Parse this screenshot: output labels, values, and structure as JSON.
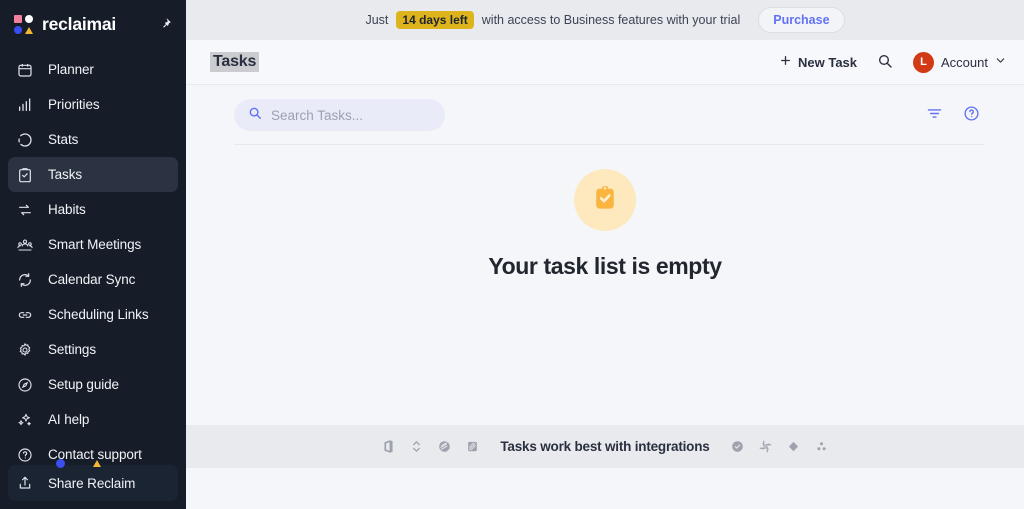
{
  "brand": {
    "name": "reclaimai",
    "logo_icon": "reclaim-logo-icon",
    "pin_icon": "pin-icon"
  },
  "sidebar": {
    "items": [
      {
        "label": "Planner",
        "icon": "calendar-icon",
        "active": false
      },
      {
        "label": "Priorities",
        "icon": "bar-chart-icon",
        "active": false
      },
      {
        "label": "Stats",
        "icon": "activity-circle-icon",
        "active": false
      },
      {
        "label": "Tasks",
        "icon": "clipboard-check-icon",
        "active": true
      },
      {
        "label": "Habits",
        "icon": "repeat-icon",
        "active": false
      },
      {
        "label": "Smart Meetings",
        "icon": "people-group-icon",
        "active": false
      },
      {
        "label": "Calendar Sync",
        "icon": "sync-refresh-icon",
        "active": false
      },
      {
        "label": "Scheduling Links",
        "icon": "link-icon",
        "active": false
      },
      {
        "label": "Settings",
        "icon": "gear-icon",
        "active": false
      },
      {
        "label": "Setup guide",
        "icon": "compass-icon",
        "active": false
      },
      {
        "label": "AI help",
        "icon": "sparkles-icon",
        "active": false
      },
      {
        "label": "Contact support",
        "icon": "question-circle-icon",
        "active": false
      }
    ],
    "share": {
      "label": "Share Reclaim",
      "icon": "share-upload-icon",
      "badge_dot_color": "#3b4ef0",
      "badge_triangle_color": "#f5b731"
    }
  },
  "banner": {
    "prefix": "Just",
    "highlight": "14 days left",
    "suffix": "with access to Business features with your trial",
    "purchase_label": "Purchase",
    "highlight_color": "#ddb41c",
    "purchase_color": "#6272f3"
  },
  "topbar": {
    "title": "Tasks",
    "new_task_label": "New Task",
    "plus_icon": "plus-icon",
    "search_icon": "search-icon",
    "account_label": "Account",
    "account_initial": "L",
    "avatar_color": "#d23a16",
    "chevron_icon": "chevron-down-icon"
  },
  "toolbar": {
    "search_placeholder": "Search Tasks...",
    "search_value": "",
    "search_icon": "search-icon",
    "filter_icon": "filter-icon",
    "help_icon": "help-circle-icon",
    "accent_color": "#6272f3"
  },
  "empty_state": {
    "title": "Your task list is empty",
    "icon": "clipboard-check-icon",
    "circle_color": "#fde9bd",
    "icon_color": "#f9b53f"
  },
  "integrations": {
    "label": "Tasks work best with integrations",
    "left_icons": [
      "microsoft-office-icon",
      "google-tasks-sync-icon",
      "todoist-icon",
      "jira-icon"
    ],
    "right_icons": [
      "asana-check-icon",
      "slack-icon",
      "clickup-icon",
      "linear-dots-icon"
    ]
  }
}
